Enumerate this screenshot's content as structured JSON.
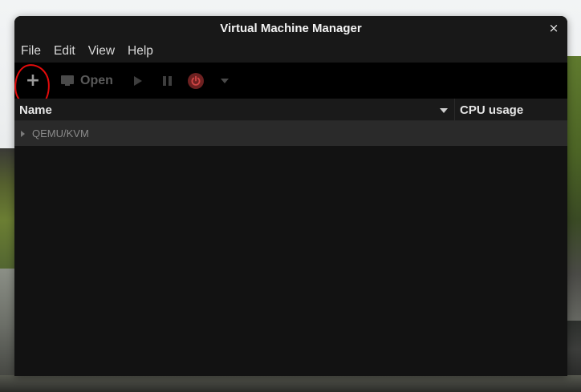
{
  "window": {
    "title": "Virtual Machine Manager",
    "close_glyph": "×"
  },
  "menu": {
    "items": [
      "File",
      "Edit",
      "View",
      "Help"
    ]
  },
  "toolbar": {
    "new_glyph": "+",
    "open_label": "Open",
    "icons": {
      "new": "plus-icon",
      "open": "monitor-icon",
      "run": "play-icon",
      "pause": "pause-icon",
      "shutdown": "power-icon",
      "shutdown_menu": "chevron-down-icon"
    }
  },
  "annotation": {
    "shape": "hand-drawn circle around new VM button",
    "color": "#e30b0b"
  },
  "columns": {
    "name": "Name",
    "cpu": "CPU usage"
  },
  "connections": [
    {
      "label": "QEMU/KVM",
      "expanded": false
    }
  ],
  "colors": {
    "window_bg": "#121212",
    "toolbar_bg": "#000000",
    "row_bg": "#2a2a2a",
    "shutdown_red": "#6e2121"
  }
}
